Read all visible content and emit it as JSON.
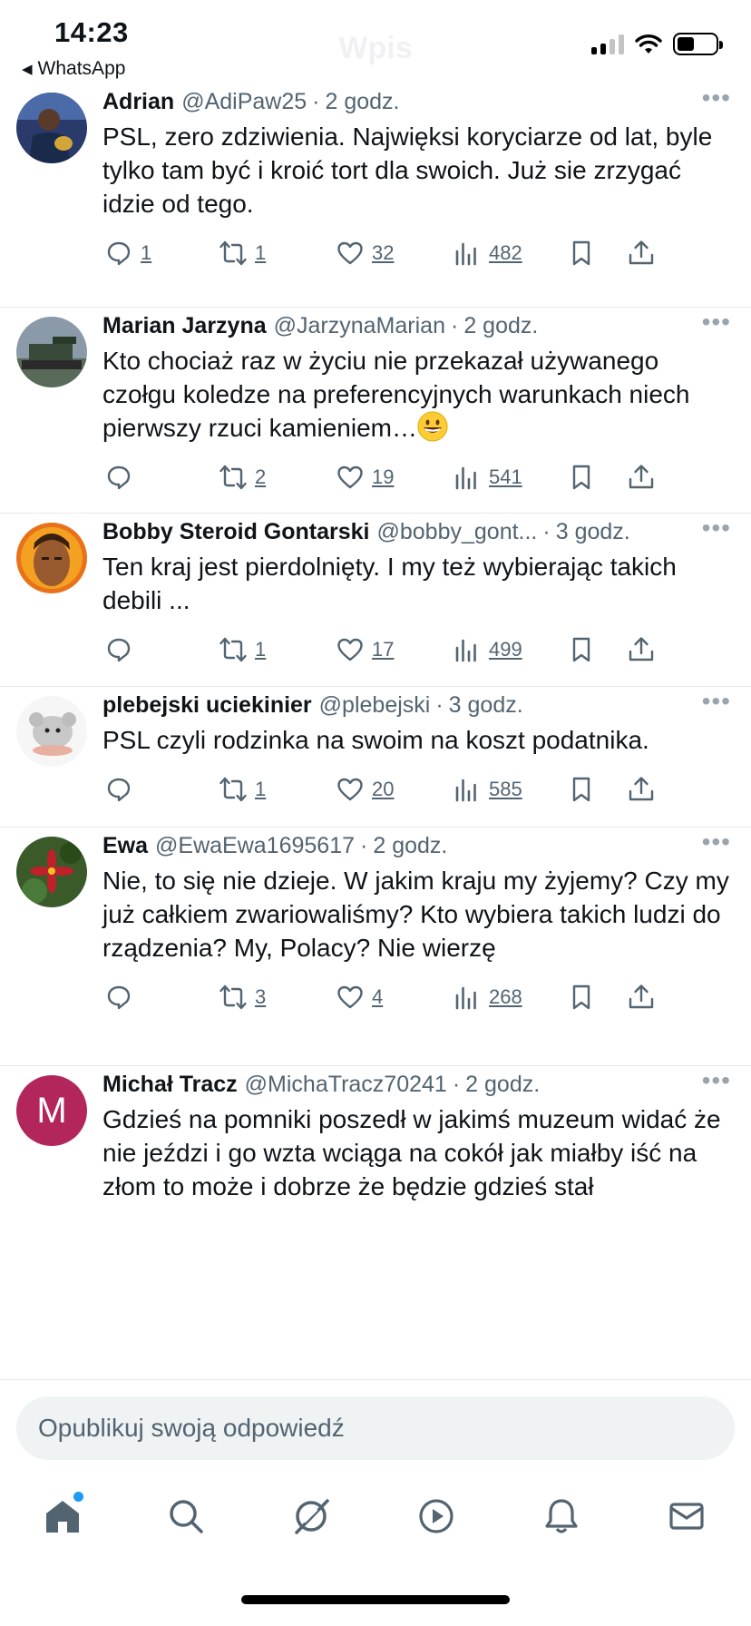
{
  "status_bar": {
    "time": "14:23",
    "back_app": "WhatsApp",
    "faded_title": "Wpis"
  },
  "tweets": [
    {
      "name": "Adrian",
      "handle": "@AdiPaw25",
      "time": "2 godz.",
      "text": "PSL, zero zdziwienia. Najwięksi koryciarze od lat, byle tylko tam być i kroić tort dla swoich. Już sie zrzygać idzie od tego.",
      "replies": "1",
      "retweets": "1",
      "likes": "32",
      "views": "482",
      "avatar_icon": "photo-avatar-icon"
    },
    {
      "name": "Marian Jarzyna",
      "handle": "@JarzynaMarian",
      "time": "2 godz.",
      "text": "Kto chociaż raz w życiu nie przekazał używanego czołgu koledze na preferencyjnych warunkach niech pierwszy rzuci kamieniem…",
      "emoji": "grinning-face-emoji",
      "replies": "",
      "retweets": "2",
      "likes": "19",
      "views": "541",
      "avatar_icon": "tank-photo-avatar-icon"
    },
    {
      "name": "Bobby Steroid Gontarski",
      "handle": "@bobby_gont...",
      "time": "3 godz.",
      "text": "Ten kraj jest pierdolnięty. I my też wybierając takich debili ...",
      "replies": "",
      "retweets": "1",
      "likes": "17",
      "views": "499",
      "avatar_icon": "illustrated-face-avatar-icon"
    },
    {
      "name": "plebejski uciekinier",
      "handle": "@plebejski",
      "time": "3 godz.",
      "text": "PSL czyli rodzinka na swoim na koszt podatnika.",
      "replies": "",
      "retweets": "1",
      "likes": "20",
      "views": "585",
      "avatar_icon": "plush-toy-avatar-icon"
    },
    {
      "name": "Ewa",
      "handle": "@EwaEwa1695617",
      "time": "2 godz.",
      "text": "Nie, to się nie dzieje. W jakim kraju my żyjemy? Czy my już całkiem zwariowaliśmy? Kto wybiera takich ludzi do rządzenia? My, Polacy? Nie wierzę",
      "replies": "",
      "retweets": "3",
      "likes": "4",
      "views": "268",
      "avatar_icon": "red-flower-avatar-icon"
    },
    {
      "name": "Michał Tracz",
      "handle": "@MichaTracz70241",
      "time": "2 godz.",
      "text": "Gdzieś na pomniki poszedł w jakimś muzeum widać że nie jeździ i go wzta wciąga na cokół jak miałby iść na złom to może i dobrze że będzie gdzieś stał",
      "avatar_letter": "M",
      "avatar_color": "#b3265c"
    }
  ],
  "reply_bar": {
    "placeholder": "Opublikuj swoją odpowiedź"
  },
  "tab_bar": {
    "items": [
      "home-icon",
      "search-icon",
      "grok-icon",
      "video-icon",
      "notifications-icon",
      "messages-icon"
    ]
  },
  "colors": {
    "text": "#0f1419",
    "secondary": "#536471",
    "divider": "#e6e9ec",
    "accent": "#1d9bf0",
    "input_bg": "#eff3f4"
  }
}
